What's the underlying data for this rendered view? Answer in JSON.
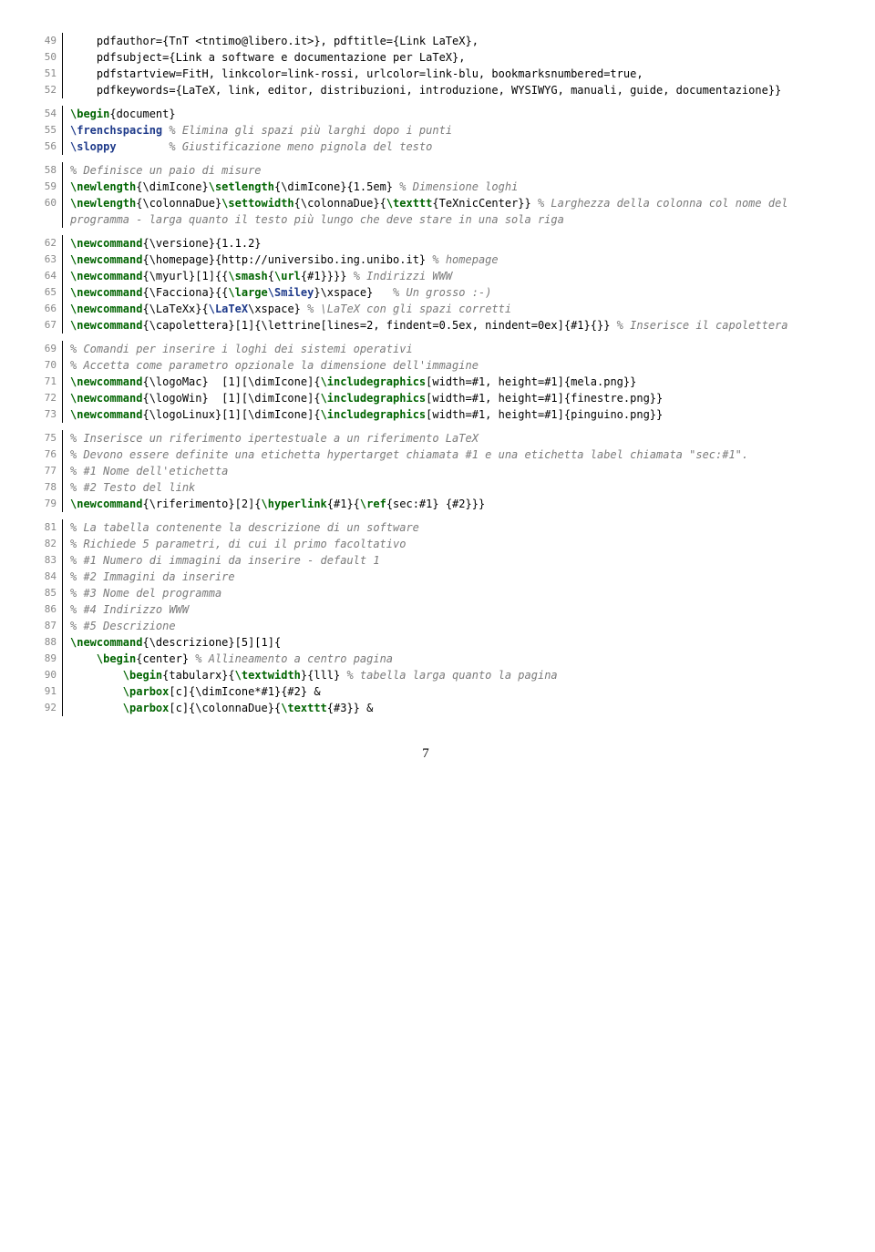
{
  "page_number": "7",
  "lines": [
    {
      "n": "49",
      "segs": [
        {
          "t": "    pdfauthor={TnT <tntimo@libero.it>}, pdftitle={Link LaTeX},"
        }
      ]
    },
    {
      "n": "50",
      "segs": [
        {
          "t": "    pdfsubject={Link a software e documentazione per LaTeX},"
        }
      ]
    },
    {
      "n": "51",
      "segs": [
        {
          "t": "    pdfstartview=FitH, linkcolor=link-rossi, urlcolor=link-blu, bookmarksnumbered=true,"
        }
      ]
    },
    {
      "n": "52",
      "segs": [
        {
          "t": "    pdfkeywords={LaTeX, link, editor, distribuzioni, introduzione, WYSIWYG, manuali, guide, documentazione}}"
        }
      ]
    },
    {
      "gap": true
    },
    {
      "n": "54",
      "segs": [
        {
          "t": "\\begin",
          "c": "kw"
        },
        {
          "t": "{document}"
        }
      ]
    },
    {
      "n": "55",
      "segs": [
        {
          "t": "\\frenchspacing",
          "c": "cmd"
        },
        {
          "t": " "
        },
        {
          "t": "% Elimina gli spazi più larghi dopo i punti",
          "c": "cmt"
        }
      ]
    },
    {
      "n": "56",
      "segs": [
        {
          "t": "\\sloppy",
          "c": "cmd"
        },
        {
          "t": "        "
        },
        {
          "t": "% Giustificazione meno pignola del testo",
          "c": "cmt"
        }
      ]
    },
    {
      "gap": true
    },
    {
      "n": "58",
      "segs": [
        {
          "t": "% Definisce un paio di misure",
          "c": "cmt"
        }
      ]
    },
    {
      "n": "59",
      "segs": [
        {
          "t": "\\newlength",
          "c": "kw"
        },
        {
          "t": "{\\dimIcone}"
        },
        {
          "t": "\\setlength",
          "c": "kw"
        },
        {
          "t": "{\\dimIcone}{1.5em} "
        },
        {
          "t": "% Dimensione loghi",
          "c": "cmt"
        }
      ]
    },
    {
      "n": "60",
      "segs": [
        {
          "t": "\\newlength",
          "c": "kw"
        },
        {
          "t": "{\\colonnaDue}"
        },
        {
          "t": "\\settowidth",
          "c": "kw"
        },
        {
          "t": "{\\colonnaDue}{"
        },
        {
          "t": "\\texttt",
          "c": "kw"
        },
        {
          "t": "{TeXnicCenter}} "
        },
        {
          "t": "% Larghezza della colonna col nome del programma - larga quanto il testo più lungo che deve stare in una sola riga",
          "c": "cmt"
        }
      ]
    },
    {
      "gap": true
    },
    {
      "n": "62",
      "segs": [
        {
          "t": "\\newcommand",
          "c": "kw"
        },
        {
          "t": "{\\versione}{1.1.2}"
        }
      ]
    },
    {
      "n": "63",
      "segs": [
        {
          "t": "\\newcommand",
          "c": "kw"
        },
        {
          "t": "{\\homepage}{http://universibo.ing.unibo.it} "
        },
        {
          "t": "% homepage",
          "c": "cmt"
        }
      ]
    },
    {
      "n": "64",
      "segs": [
        {
          "t": "\\newcommand",
          "c": "kw"
        },
        {
          "t": "{\\myurl}[1]{{"
        },
        {
          "t": "\\smash",
          "c": "kw"
        },
        {
          "t": "{"
        },
        {
          "t": "\\url",
          "c": "kw"
        },
        {
          "t": "{#1}}}} "
        },
        {
          "t": "% Indirizzi WWW",
          "c": "cmt"
        }
      ]
    },
    {
      "n": "65",
      "segs": [
        {
          "t": "\\newcommand",
          "c": "kw"
        },
        {
          "t": "{\\Facciona}{{"
        },
        {
          "t": "\\large",
          "c": "kw"
        },
        {
          "t": "\\Smiley",
          "c": "cmd"
        },
        {
          "t": "}\\xspace}   "
        },
        {
          "t": "% Un grosso :-)",
          "c": "cmt"
        }
      ]
    },
    {
      "n": "66",
      "segs": [
        {
          "t": "\\newcommand",
          "c": "kw"
        },
        {
          "t": "{\\LaTeXx}{"
        },
        {
          "t": "\\LaTeX",
          "c": "cmd"
        },
        {
          "t": "\\xspace} "
        },
        {
          "t": "% \\LaTeX con gli spazi corretti",
          "c": "cmt"
        }
      ]
    },
    {
      "n": "67",
      "segs": [
        {
          "t": "\\newcommand",
          "c": "kw"
        },
        {
          "t": "{\\capolettera}[1]{\\lettrine[lines=2, findent=0.5ex, nindent=0ex]{#1}{}} "
        },
        {
          "t": "% Inserisce il capolettera",
          "c": "cmt"
        }
      ]
    },
    {
      "gap": true
    },
    {
      "n": "69",
      "segs": [
        {
          "t": "% Comandi per inserire i loghi dei sistemi operativi",
          "c": "cmt"
        }
      ]
    },
    {
      "n": "70",
      "segs": [
        {
          "t": "% Accetta come parametro opzionale la dimensione dell'immagine",
          "c": "cmt"
        }
      ]
    },
    {
      "n": "71",
      "segs": [
        {
          "t": "\\newcommand",
          "c": "kw"
        },
        {
          "t": "{\\logoMac}  [1][\\dimIcone]{"
        },
        {
          "t": "\\includegraphics",
          "c": "kw"
        },
        {
          "t": "[width=#1, height=#1]{mela.png}}"
        }
      ]
    },
    {
      "n": "72",
      "segs": [
        {
          "t": "\\newcommand",
          "c": "kw"
        },
        {
          "t": "{\\logoWin}  [1][\\dimIcone]{"
        },
        {
          "t": "\\includegraphics",
          "c": "kw"
        },
        {
          "t": "[width=#1, height=#1]{finestre.png}}"
        }
      ]
    },
    {
      "n": "73",
      "segs": [
        {
          "t": "\\newcommand",
          "c": "kw"
        },
        {
          "t": "{\\logoLinux}[1][\\dimIcone]{"
        },
        {
          "t": "\\includegraphics",
          "c": "kw"
        },
        {
          "t": "[width=#1, height=#1]{pinguino.png}}"
        }
      ]
    },
    {
      "gap": true
    },
    {
      "n": "75",
      "segs": [
        {
          "t": "% Inserisce un riferimento ipertestuale a un riferimento LaTeX",
          "c": "cmt"
        }
      ]
    },
    {
      "n": "76",
      "segs": [
        {
          "t": "% Devono essere definite una etichetta hypertarget chiamata #1 e una etichetta label chiamata \"sec:#1\".",
          "c": "cmt"
        }
      ]
    },
    {
      "n": "77",
      "segs": [
        {
          "t": "% #1 Nome dell'etichetta",
          "c": "cmt"
        }
      ]
    },
    {
      "n": "78",
      "segs": [
        {
          "t": "% #2 Testo del link",
          "c": "cmt"
        }
      ]
    },
    {
      "n": "79",
      "segs": [
        {
          "t": "\\newcommand",
          "c": "kw"
        },
        {
          "t": "{\\riferimento}[2]{"
        },
        {
          "t": "\\hyperlink",
          "c": "kw"
        },
        {
          "t": "{#1}{"
        },
        {
          "t": "\\ref",
          "c": "kw"
        },
        {
          "t": "{sec:#1} {#2}}}"
        }
      ]
    },
    {
      "gap": true
    },
    {
      "n": "81",
      "segs": [
        {
          "t": "% La tabella contenente la descrizione di un software",
          "c": "cmt"
        }
      ]
    },
    {
      "n": "82",
      "segs": [
        {
          "t": "% Richiede 5 parametri, di cui il primo facoltativo",
          "c": "cmt"
        }
      ]
    },
    {
      "n": "83",
      "segs": [
        {
          "t": "% #1 Numero di immagini da inserire - default 1",
          "c": "cmt"
        }
      ]
    },
    {
      "n": "84",
      "segs": [
        {
          "t": "% #2 Immagini da inserire",
          "c": "cmt"
        }
      ]
    },
    {
      "n": "85",
      "segs": [
        {
          "t": "% #3 Nome del programma",
          "c": "cmt"
        }
      ]
    },
    {
      "n": "86",
      "segs": [
        {
          "t": "% #4 Indirizzo WWW",
          "c": "cmt"
        }
      ]
    },
    {
      "n": "87",
      "segs": [
        {
          "t": "% #5 Descrizione",
          "c": "cmt"
        }
      ]
    },
    {
      "n": "88",
      "segs": [
        {
          "t": "\\newcommand",
          "c": "kw"
        },
        {
          "t": "{\\descrizione}[5][1]{"
        }
      ]
    },
    {
      "n": "89",
      "segs": [
        {
          "t": "    "
        },
        {
          "t": "\\begin",
          "c": "kw"
        },
        {
          "t": "{center} "
        },
        {
          "t": "% Allineamento a centro pagina",
          "c": "cmt"
        }
      ]
    },
    {
      "n": "90",
      "segs": [
        {
          "t": "        "
        },
        {
          "t": "\\begin",
          "c": "kw"
        },
        {
          "t": "{tabularx}{"
        },
        {
          "t": "\\textwidth",
          "c": "kw"
        },
        {
          "t": "}{lll} "
        },
        {
          "t": "% tabella larga quanto la pagina",
          "c": "cmt"
        }
      ]
    },
    {
      "n": "91",
      "segs": [
        {
          "t": "        "
        },
        {
          "t": "\\parbox",
          "c": "kw"
        },
        {
          "t": "[c]{\\dimIcone*#1}{#2} &"
        }
      ]
    },
    {
      "n": "92",
      "segs": [
        {
          "t": "        "
        },
        {
          "t": "\\parbox",
          "c": "kw"
        },
        {
          "t": "[c]{\\colonnaDue}{"
        },
        {
          "t": "\\texttt",
          "c": "kw"
        },
        {
          "t": "{#3}} &"
        }
      ]
    }
  ]
}
